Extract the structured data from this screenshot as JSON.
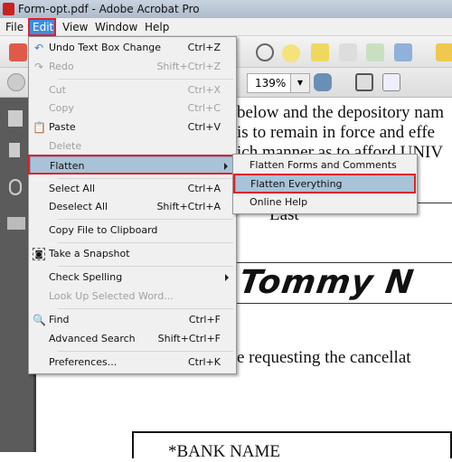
{
  "window": {
    "title": "Form-opt.pdf - Adobe Acrobat Pro"
  },
  "menubar": [
    "File",
    "Edit",
    "View",
    "Window",
    "Help"
  ],
  "toolbar": {
    "zoom": "139%"
  },
  "document": {
    "lines": [
      "below and the depository nam",
      "is to remain in force and effe",
      "ich manner as to afford UNIV"
    ],
    "last_label": "Last",
    "signature": "Tommy N",
    "requesting": "e requesting the cancellat",
    "bank_name": "*BANK NAME"
  },
  "edit_menu": [
    {
      "label": "Undo Text Box Change",
      "shortcut": "Ctrl+Z",
      "icon": "undo-icon"
    },
    {
      "label": "Redo",
      "shortcut": "Shift+Ctrl+Z",
      "disabled": true,
      "icon": "redo-icon"
    },
    {
      "label": "Cut",
      "shortcut": "Ctrl+X",
      "disabled": true
    },
    {
      "label": "Copy",
      "shortcut": "Ctrl+C",
      "disabled": true
    },
    {
      "label": "Paste",
      "shortcut": "Ctrl+V",
      "icon": "paste-icon"
    },
    {
      "label": "Delete",
      "disabled": true
    },
    {
      "label": "Flatten",
      "submenu": true,
      "highlighted": true
    },
    {
      "label": "Select All",
      "shortcut": "Ctrl+A"
    },
    {
      "label": "Deselect All",
      "shortcut": "Shift+Ctrl+A"
    },
    {
      "label": "Copy File to Clipboard"
    },
    {
      "label": "Take a Snapshot",
      "icon": "camera-icon"
    },
    {
      "label": "Check Spelling",
      "submenu": true
    },
    {
      "label": "Look Up Selected Word...",
      "disabled": true
    },
    {
      "label": "Find",
      "shortcut": "Ctrl+F",
      "icon": "find-icon"
    },
    {
      "label": "Advanced Search",
      "shortcut": "Shift+Ctrl+F"
    },
    {
      "label": "Preferences...",
      "shortcut": "Ctrl+K"
    }
  ],
  "flatten_submenu": [
    {
      "label": "Flatten Forms and Comments"
    },
    {
      "label": "Flatten Everything",
      "highlighted": true
    },
    {
      "label": "Online Help"
    }
  ],
  "colors": {
    "highlight": "#a8c3d8",
    "annotation_red": "#e0202a",
    "menu_bg": "#f0f0f0"
  }
}
